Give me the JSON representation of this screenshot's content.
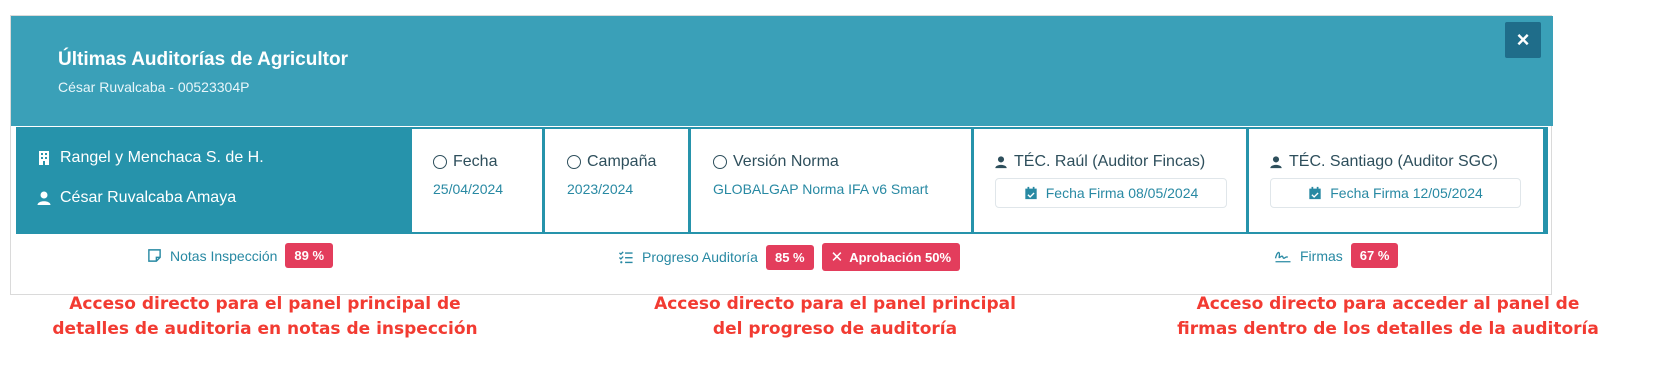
{
  "modal": {
    "title": "Últimas Auditorías de Agricultor",
    "subtitle": "César Ruvalcaba - 00523304P",
    "close_label": "×"
  },
  "info": {
    "company": "Rangel y Menchaca S. de H.",
    "farmer": "César Ruvalcaba Amaya",
    "fecha_label": "Fecha",
    "fecha_value": "25/04/2024",
    "campana_label": "Campaña",
    "campana_value": "2023/2024",
    "version_label": "Versión Norma",
    "version_value": "GLOBALGAP Norma IFA v6 Smart",
    "tec1_label": "TÉC. Raúl (Auditor Fincas)",
    "tec1_sign": "Fecha Firma 08/05/2024",
    "tec2_label": "TÉC. Santiago (Auditor SGC)",
    "tec2_sign": "Fecha Firma 12/05/2024"
  },
  "strip": {
    "notas_label": "Notas Inspección",
    "notas_badge": "89 %",
    "progreso_label": "Progreso Auditoría",
    "progreso_badge": "85 %",
    "aprobacion_label": "Aprobación 50%",
    "firmas_label": "Firmas",
    "firmas_badge": "67 %"
  },
  "annotations": {
    "notas_line1": "Acceso directo para el panel principal de",
    "notas_line2": "detalles de auditoria en notas de inspección",
    "progreso_line1": "Acceso directo para el panel principal",
    "progreso_line2": "del progreso de auditoría",
    "firmas_line1": "Acceso directo para acceder al panel de",
    "firmas_line2": "firmas dentro de los detalles de la auditoría"
  },
  "colors": {
    "header": "#3aa0b8",
    "info_bar": "#2693ab",
    "badge": "#e33d5c",
    "annotation": "#f23b32"
  }
}
